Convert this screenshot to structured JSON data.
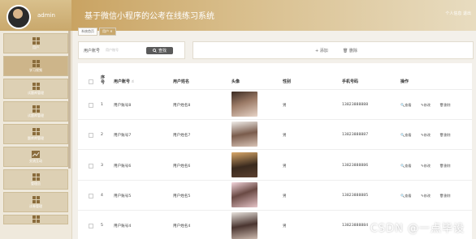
{
  "sidebar": {
    "user_name": "admin",
    "items": [
      {
        "label": "用户"
      },
      {
        "label": "学习视频"
      },
      {
        "label": "试题库管理"
      },
      {
        "label": "试题库管理"
      },
      {
        "label": "题库库管理"
      },
      {
        "label": "交流互动"
      },
      {
        "label": "管理员"
      },
      {
        "label": "试卷管理"
      },
      {
        "label": ""
      }
    ]
  },
  "header": {
    "title": "基于微信小程序的公考在线练习系统",
    "right": "个人信息 退出"
  },
  "breadcrumbs": {
    "items": [
      "系统首页",
      "用户 ✕"
    ]
  },
  "search": {
    "label": "用户账号",
    "placeholder": "用户账号",
    "button": "查找"
  },
  "actions": {
    "add": "添加",
    "delete": "删除"
  },
  "table": {
    "headers": {
      "index": "序号",
      "account": "用户账号",
      "name": "用户姓名",
      "photo": "头像",
      "gender": "性别",
      "phone": "手机号码",
      "ops": "操作"
    },
    "ops": {
      "view": "查看",
      "edit": "修改",
      "delete": "删除"
    },
    "rows": [
      {
        "index": "1",
        "account": "用户账号8",
        "name": "用户姓名8",
        "gender": "男",
        "phone": "13823888888"
      },
      {
        "index": "2",
        "account": "用户账号7",
        "name": "用户姓名7",
        "gender": "男",
        "phone": "13823888887"
      },
      {
        "index": "3",
        "account": "用户账号6",
        "name": "用户姓名6",
        "gender": "男",
        "phone": "13823888886"
      },
      {
        "index": "4",
        "account": "用户账号5",
        "name": "用户姓名5",
        "gender": "男",
        "phone": "13823888885"
      },
      {
        "index": "5",
        "account": "用户账号4",
        "name": "用户姓名4",
        "gender": "男",
        "phone": "13823888884"
      }
    ]
  },
  "watermark": "CSDN @一点毕设",
  "colors": {
    "accent": "#c9a86c",
    "sidebar": "#efe9dc"
  }
}
